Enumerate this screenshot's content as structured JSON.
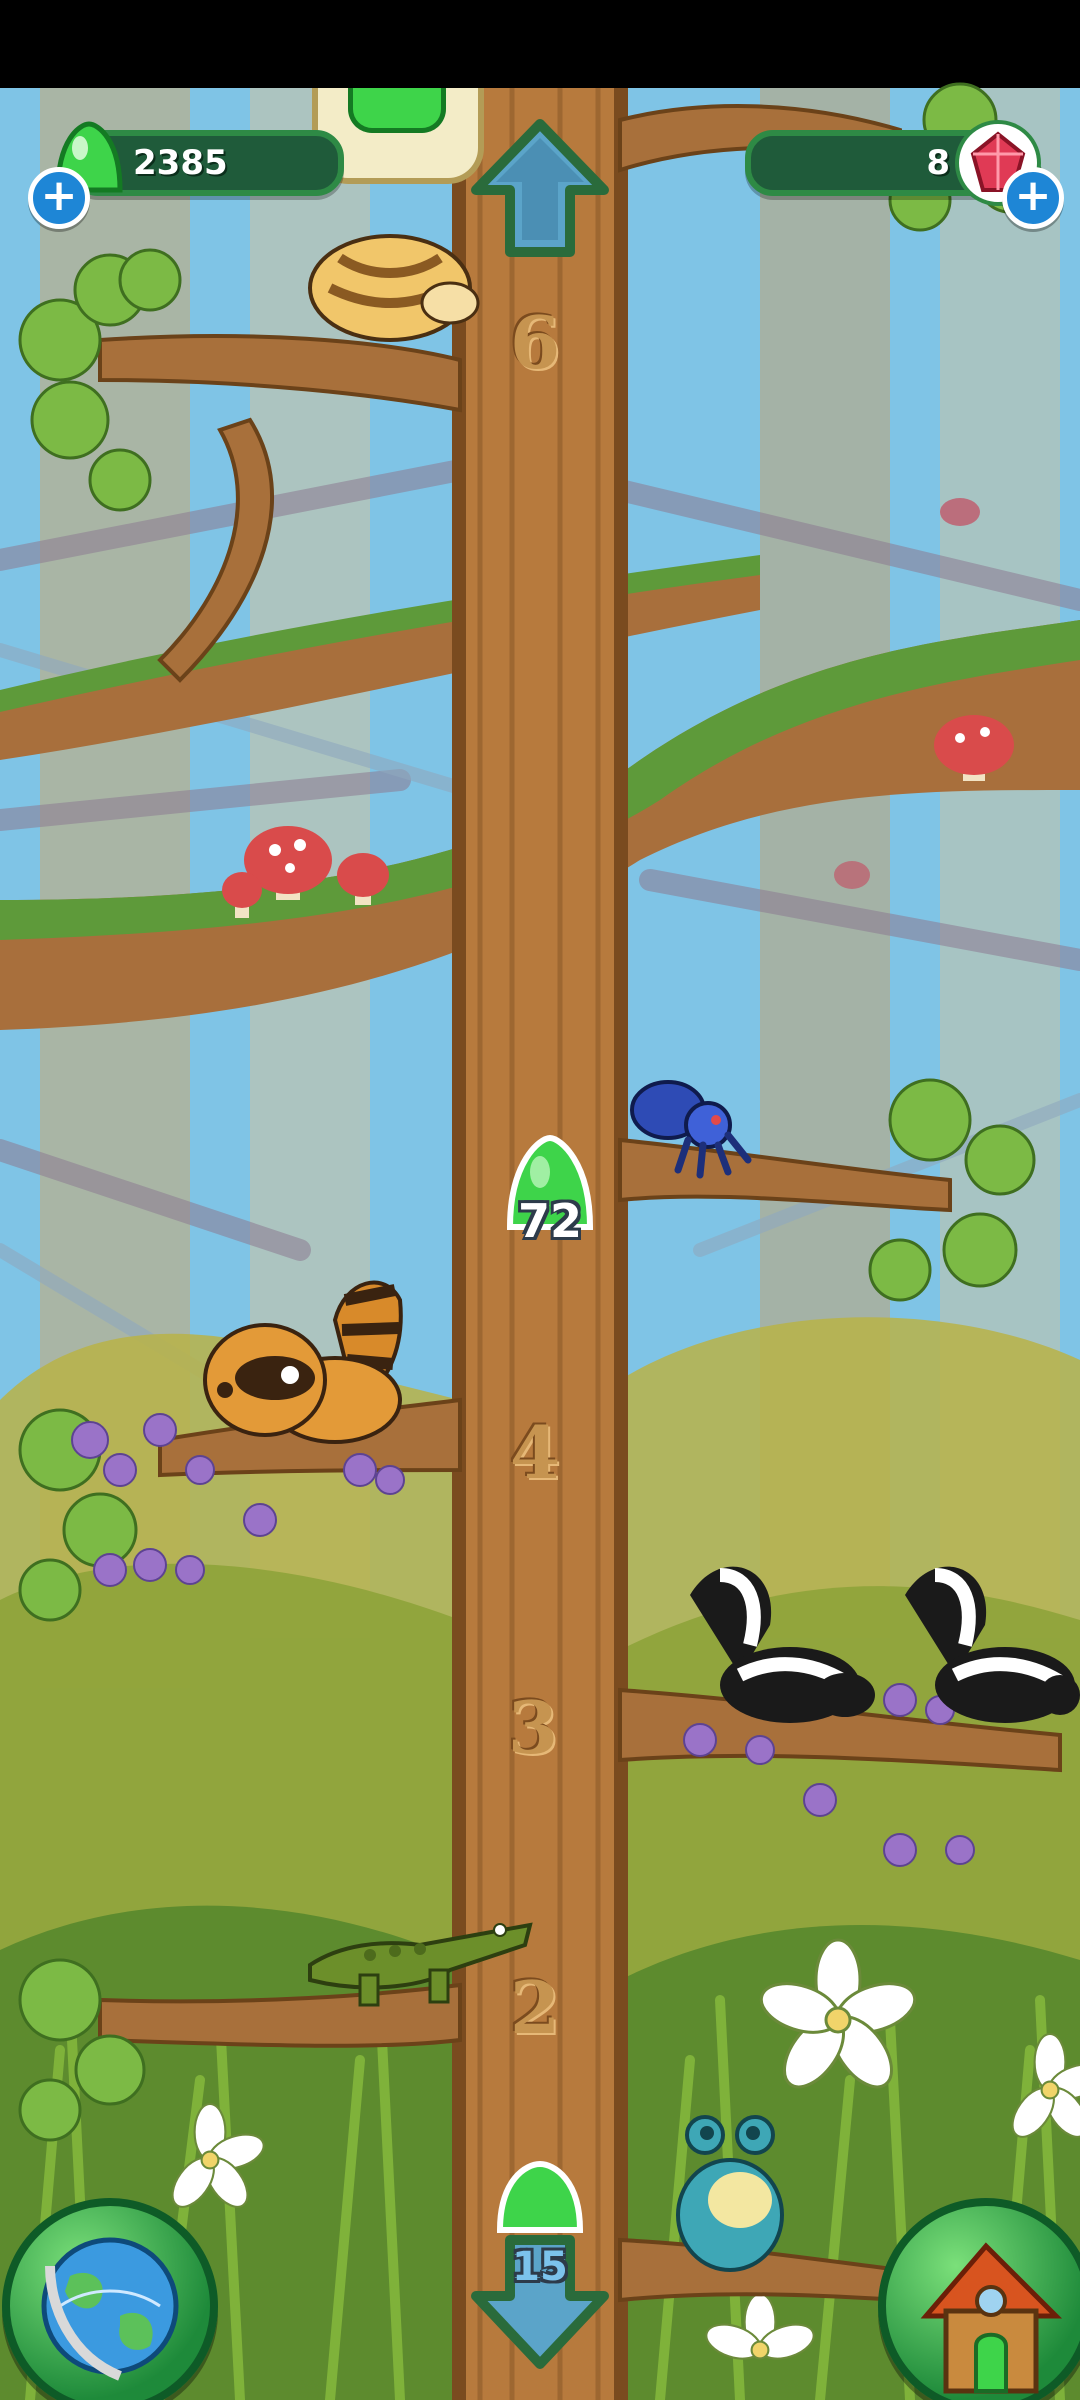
{
  "hud": {
    "gum_count": "2385",
    "gem_count": "8"
  },
  "tree": {
    "levels": [
      "6",
      "4",
      "3",
      "2"
    ]
  },
  "gum_drop": {
    "count": "72"
  },
  "bottom": {
    "down_count": "15"
  },
  "icons": {
    "up": "up-arrow-icon",
    "down": "down-arrow-icon",
    "world": "globe-icon",
    "home": "treehouse-icon",
    "gum": "green-gum-icon",
    "gem": "red-gem-icon"
  },
  "colors": {
    "sky": "#7fc4e6",
    "trunk": "#b77a3d",
    "leaf": "#6fa83a",
    "hud_fill": "#1f5b3a",
    "hud_border": "#2e8a45",
    "plus_blue": "#1e86d6"
  }
}
